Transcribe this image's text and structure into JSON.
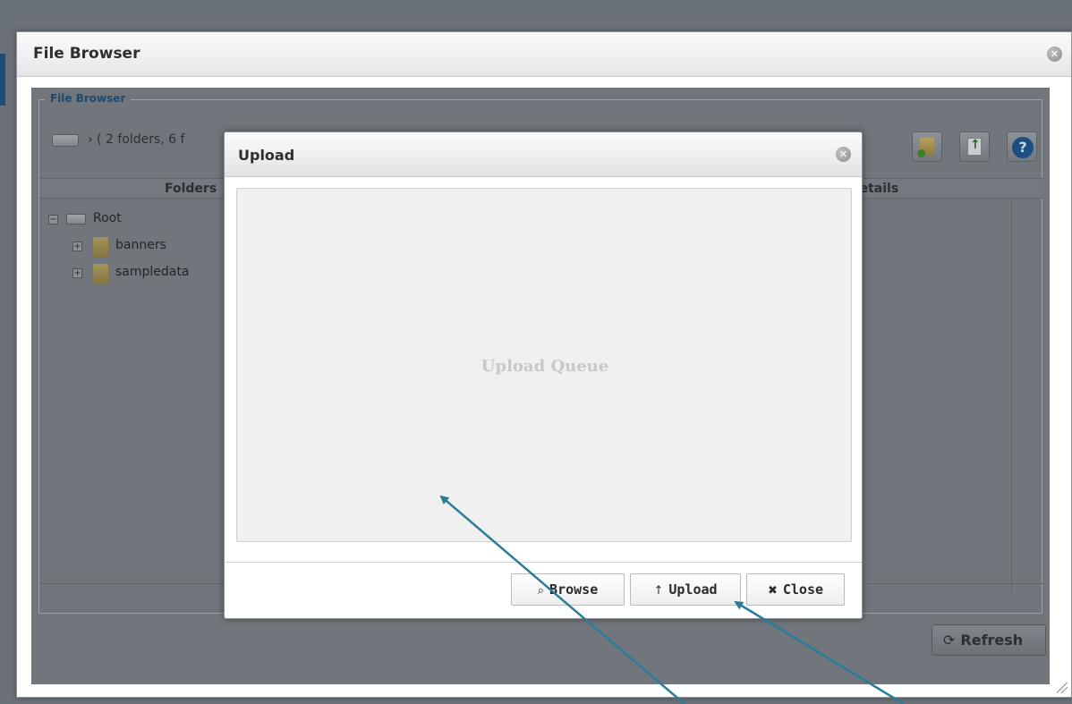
{
  "outer_dialog": {
    "title": "File Browser",
    "close_icon": "close-icon"
  },
  "file_browser": {
    "legend": "File Browser",
    "path_text": "› ( 2 folders, 6 f",
    "toolbar": {
      "new_folder_icon": "new-folder-icon",
      "upload_icon": "upload-icon",
      "help_icon": "help-icon",
      "help_glyph": "?"
    },
    "columns": {
      "folders": "Folders",
      "details": "Details"
    },
    "tree": {
      "root": {
        "label": "Root",
        "toggle": "−"
      },
      "items": [
        {
          "label": "banners",
          "toggle": "+"
        },
        {
          "label": "sampledata",
          "toggle": "+"
        }
      ]
    },
    "refresh": {
      "icon": "⟳",
      "label": "Refresh"
    }
  },
  "upload_dialog": {
    "title": "Upload",
    "queue_label": "Upload Queue",
    "buttons": {
      "browse": {
        "icon": "⌕",
        "label": "Browse"
      },
      "upload": {
        "icon": "↑",
        "label": "Upload"
      },
      "close": {
        "icon": "✖",
        "label": "Close"
      }
    }
  },
  "colors": {
    "annotation_arrow": "#2a7d99",
    "overlay": "#70767c",
    "legend_text": "#1c4a6e"
  }
}
